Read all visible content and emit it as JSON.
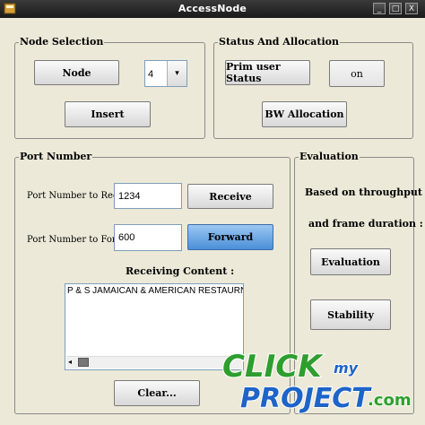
{
  "window": {
    "title": "AccessNode",
    "minimize_glyph": "_",
    "maximize_glyph": "□",
    "close_glyph": "X"
  },
  "node_selection": {
    "legend": "Node Selection",
    "node_button": "Node",
    "node_dropdown": {
      "selected": "4",
      "arrow_icon": "▾"
    },
    "insert_button": "Insert"
  },
  "status_allocation": {
    "legend": "Status And Allocation",
    "prim_status_button": "Prim user Status",
    "status_value_button": "on",
    "bw_allocation_button": "BW Allocation"
  },
  "port_number": {
    "legend": "Port Number",
    "receive_label": "Port Number to Receive :",
    "receive_value": "1234",
    "receive_button": "Receive",
    "forward_label": "Port Number to Forward :",
    "forward_value": "600",
    "forward_button": "Forward",
    "receiving_content_label": "Receiving Content :",
    "receiving_content_text": "P & S JAMAICAN & AMERICAN RESTAURNAT & CAR",
    "clear_button": "Clear..."
  },
  "evaluation": {
    "legend": "Evaluation",
    "line1": "Based on throughput",
    "line2": "and frame duration :",
    "evaluation_button": "Evaluation",
    "stability_button": "Stability"
  },
  "watermark": {
    "line1": "CLICK",
    "line2": "my",
    "line3": "PROJECT",
    "suffix": ".com"
  },
  "colors": {
    "forward_active": "#4a8fd8",
    "watermark_green": "#2e9e2e",
    "watermark_blue": "#1e64c8",
    "window_bg": "#ece9d8"
  }
}
